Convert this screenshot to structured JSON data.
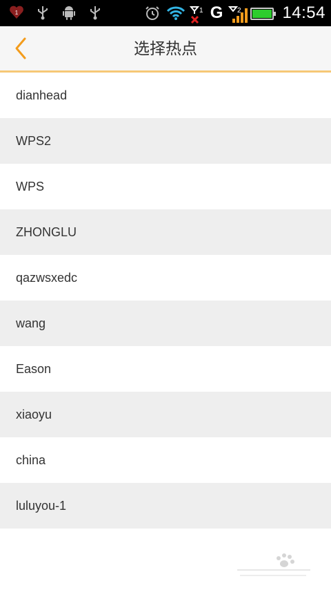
{
  "status_bar": {
    "time": "14:54",
    "network_type": "G",
    "notification_count": "1",
    "icons": [
      "heart-notification-icon",
      "usb-icon",
      "android-debug-icon",
      "usb-icon",
      "alarm-icon",
      "wifi-icon",
      "sim1-no-signal-icon",
      "sim2-signal-icon",
      "battery-icon"
    ]
  },
  "header": {
    "title": "选择热点",
    "back_icon": "chevron-left-icon"
  },
  "hotspots": [
    {
      "ssid": "dianhead"
    },
    {
      "ssid": "WPS2"
    },
    {
      "ssid": "WPS"
    },
    {
      "ssid": "ZHONGLU"
    },
    {
      "ssid": "qazwsxedc"
    },
    {
      "ssid": "wang"
    },
    {
      "ssid": "Eason"
    },
    {
      "ssid": "xiaoyu"
    },
    {
      "ssid": "china"
    },
    {
      "ssid": "luluyou-1"
    }
  ],
  "colors": {
    "accent": "#f39c1c",
    "header_border": "#f6c876",
    "row_alt": "#eeeeee"
  }
}
